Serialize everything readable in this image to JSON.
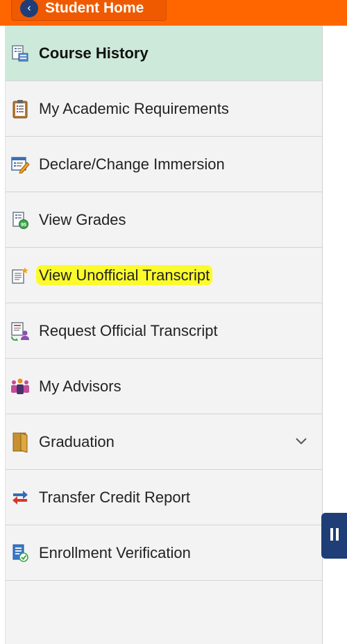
{
  "header": {
    "home_label": "Student Home",
    "home_icon": "chevron-left-icon",
    "bar_color": "#ff6600"
  },
  "sidebar": {
    "items": [
      {
        "label": "Course History",
        "icon": "course-history-icon",
        "active": true
      },
      {
        "label": "My Academic Requirements",
        "icon": "clipboard-icon"
      },
      {
        "label": "Declare/Change Immersion",
        "icon": "edit-form-icon"
      },
      {
        "label": "View Grades",
        "icon": "grades-icon"
      },
      {
        "label": "View Unofficial Transcript",
        "icon": "transcript-icon",
        "highlighted": true
      },
      {
        "label": "Request Official Transcript",
        "icon": "request-transcript-icon"
      },
      {
        "label": "My Advisors",
        "icon": "people-icon"
      },
      {
        "label": "Graduation",
        "icon": "folder-icon",
        "expandable": true
      },
      {
        "label": "Transfer Credit Report",
        "icon": "transfer-arrows-icon"
      },
      {
        "label": "Enrollment Verification",
        "icon": "verification-icon"
      }
    ],
    "active_color": "#cde9d9",
    "highlight_color": "#fbfb2c"
  },
  "collapse_button": {
    "icon": "pause-icon",
    "color": "#1f3e78"
  }
}
